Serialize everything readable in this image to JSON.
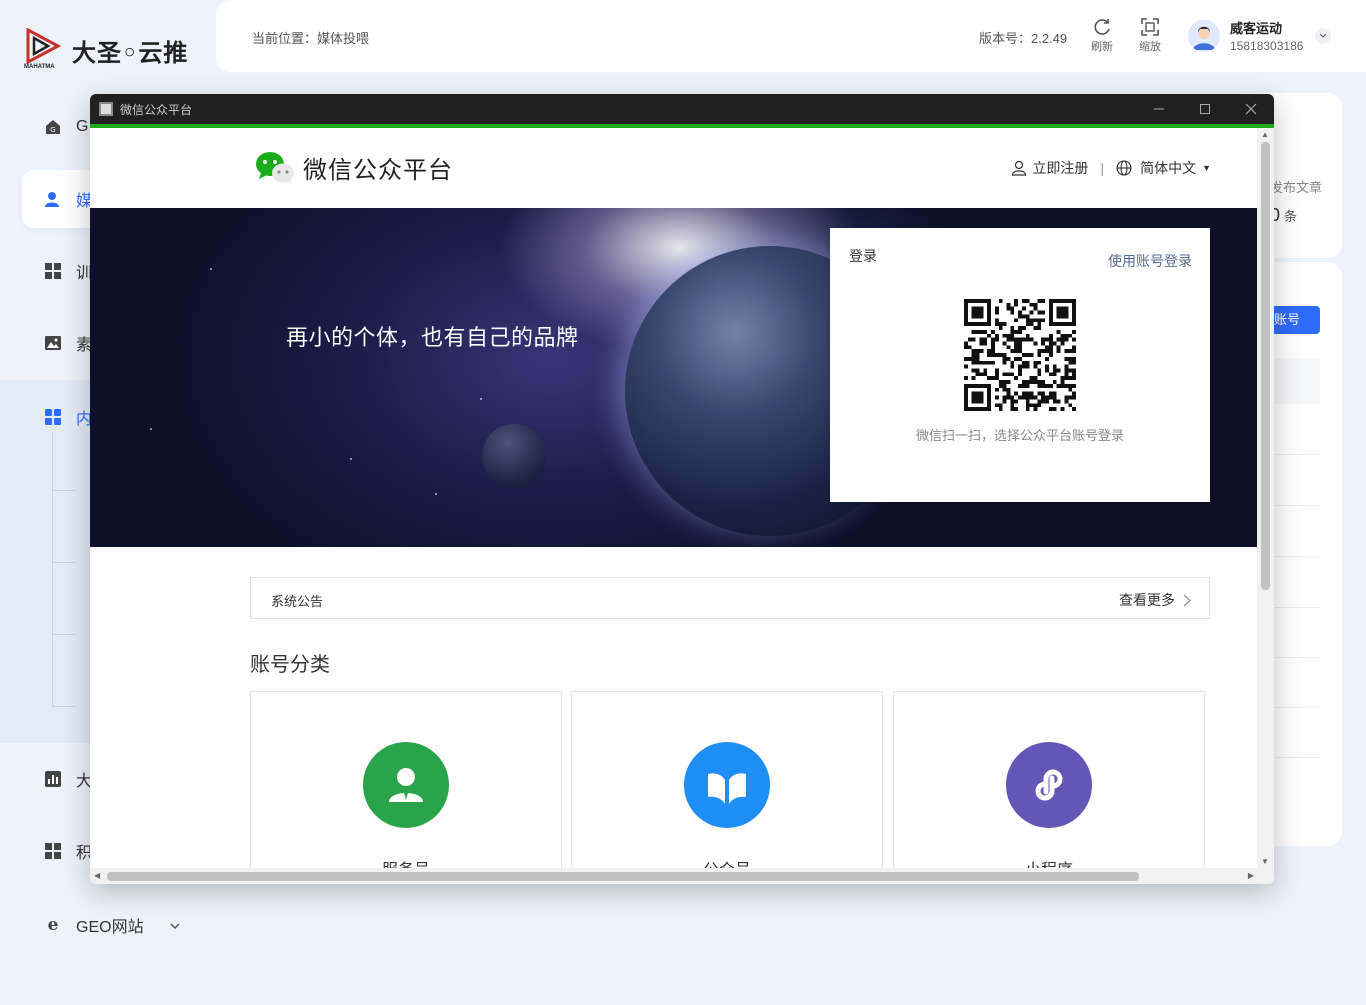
{
  "app": {
    "logo_text": "大圣◦云推",
    "logo_sub": "MAHATMA",
    "breadcrumb": "当前位置：媒体投喂",
    "version": "版本号：2.2.49",
    "refresh_label": "刷新",
    "zoom_label": "缩放",
    "user_name": "威客运动",
    "user_phone": "15818303186"
  },
  "sidebar": {
    "items": [
      {
        "label": "G"
      },
      {
        "label": "媒"
      },
      {
        "label": "训"
      },
      {
        "label": "素"
      },
      {
        "label": "内"
      },
      {
        "label": "大"
      },
      {
        "label": "积"
      },
      {
        "label": "GEO网站"
      }
    ]
  },
  "peek": {
    "stat_label": "发布文章",
    "stat_value": "0",
    "stat_unit": "条",
    "button_label": "账号"
  },
  "browser": {
    "title": "微信公众平台"
  },
  "wechat": {
    "brand": "微信公众平台",
    "register": "立即注册",
    "language": "简体中文",
    "slogan": "再小的个体，也有自己的品牌",
    "login_title": "登录",
    "login_account_link": "使用账号登录",
    "qr_tip": "微信扫一扫，选择公众平台账号登录",
    "notice_title": "系统公告",
    "notice_more": "查看更多",
    "section_title": "账号分类",
    "categories": [
      {
        "label": "服务号",
        "color": "#2aa44a",
        "icon": "service-account-icon"
      },
      {
        "label": "公众号",
        "color": "#1e8ef5",
        "icon": "official-account-icon"
      },
      {
        "label": "小程序",
        "color": "#6456b7",
        "icon": "mini-program-icon"
      }
    ]
  },
  "colors": {
    "accent": "#2f6bff",
    "wechat_green": "#1aad19",
    "link": "#576b95"
  }
}
